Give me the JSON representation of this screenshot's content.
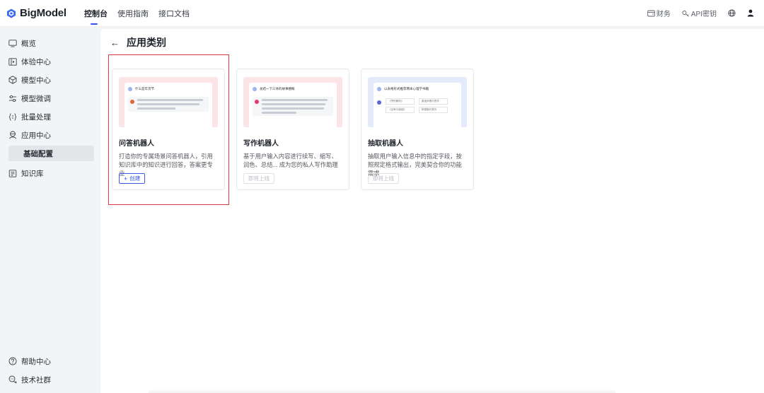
{
  "app": {
    "name": "BigModel"
  },
  "nav": [
    "控制台",
    "使用指南",
    "接口文档"
  ],
  "top_right": {
    "finance": "财务",
    "api_key": "API密钥"
  },
  "sidebar": {
    "items": [
      {
        "label": "概览",
        "icon": "monitor-icon"
      },
      {
        "label": "体验中心",
        "icon": "play-icon"
      },
      {
        "label": "模型中心",
        "icon": "cube-icon"
      },
      {
        "label": "模型微调",
        "icon": "sliders-icon"
      },
      {
        "label": "批量处理",
        "icon": "braces-icon"
      },
      {
        "label": "应用中心",
        "icon": "robot-icon"
      }
    ],
    "sub_item": "基础配置",
    "knowledge": "知识库",
    "bottom": [
      {
        "label": "帮助中心",
        "icon": "help-icon"
      },
      {
        "label": "技术社群",
        "icon": "chat-icon"
      }
    ]
  },
  "page": {
    "title": "应用类别",
    "back": "←"
  },
  "cards": [
    {
      "title": "问答机器人",
      "desc": "打造你的专属场景问答机器人，引用知识库中的知识进行回答，答案更专业",
      "button": "创建",
      "thumb_q": "什么是年货节",
      "theme": "#fce5e7",
      "bot_color": "#e8613c"
    },
    {
      "title": "写作机器人",
      "desc": "基于用户输入内容进行续写、缩写、润色、总结... 成为您的私人写作助理",
      "button": "即将上线",
      "thumb_q": "总结一下三体的故事梗概",
      "theme": "#fce5e7",
      "bot_color": "#e03a6c"
    },
    {
      "title": "抽取机器人",
      "desc": "抽取用户输入信息中的指定字段，按照规定格式输出，完美契合你的功能需求",
      "button": "即将上线",
      "thumb_q": "以表格形式推荐两本心理学书籍",
      "theme": "#e3ebfb",
      "bot_color": "#5a63d8",
      "table": [
        "《梦的解析》",
        "弗洛伊德代表作",
        "《自卑与超越》",
        "阿德勒代表作"
      ]
    }
  ],
  "colors": {
    "accent": "#2f54eb",
    "highlight": "#e0393e"
  }
}
